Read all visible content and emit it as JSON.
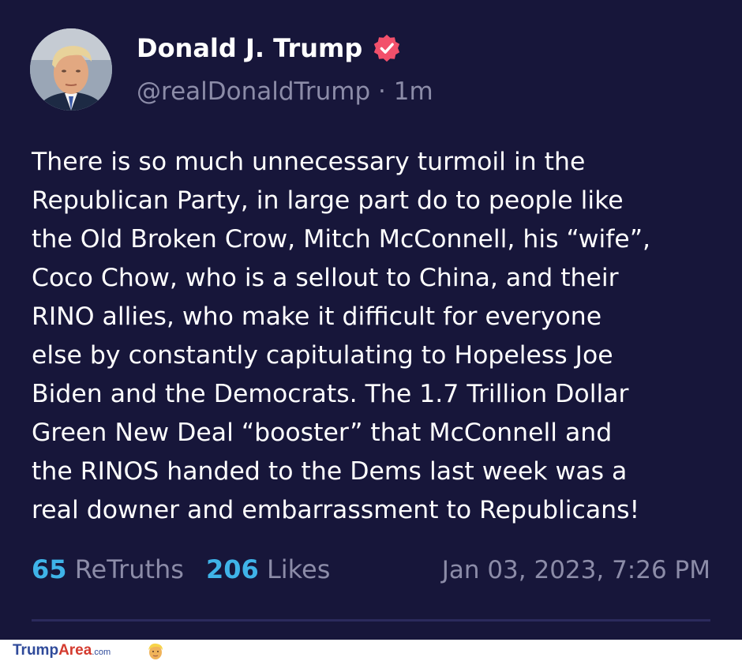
{
  "post": {
    "display_name": "Donald J. Trump",
    "handle": "@realDonaldTrump",
    "separator": "·",
    "relative_time": "1m",
    "text_lines": [
      "There is so much unnecessary turmoil in the",
      "Republican Party, in large part do to people like",
      "the Old Broken Crow, Mitch McConnell, his “wife”,",
      "Coco Chow, who is a sellout to China, and their",
      "RINO allies, who make it difficult for everyone",
      "else by constantly capitulating to Hopeless Joe",
      "Biden and the Democrats. The 1.7 Trillion Dollar",
      "Green New Deal “booster” that McConnell and",
      "the RINOS handed to the Dems last week was a",
      "real downer and embarrassment to Republicans!"
    ],
    "retruths_count": "65",
    "retruths_label": "ReTruths",
    "likes_count": "206",
    "likes_label": "Likes",
    "timestamp": "Jan 03, 2023, 7:26 PM",
    "verified_icon": "verified-badge-icon"
  },
  "footer": {
    "logo_part1": "Trump",
    "logo_part2": "Area",
    "logo_part3": ".com"
  },
  "colors": {
    "background": "#17163a",
    "accent_count": "#3fb3e8",
    "muted_text": "#8c8ca8",
    "verified_badge": "#f2506b"
  }
}
